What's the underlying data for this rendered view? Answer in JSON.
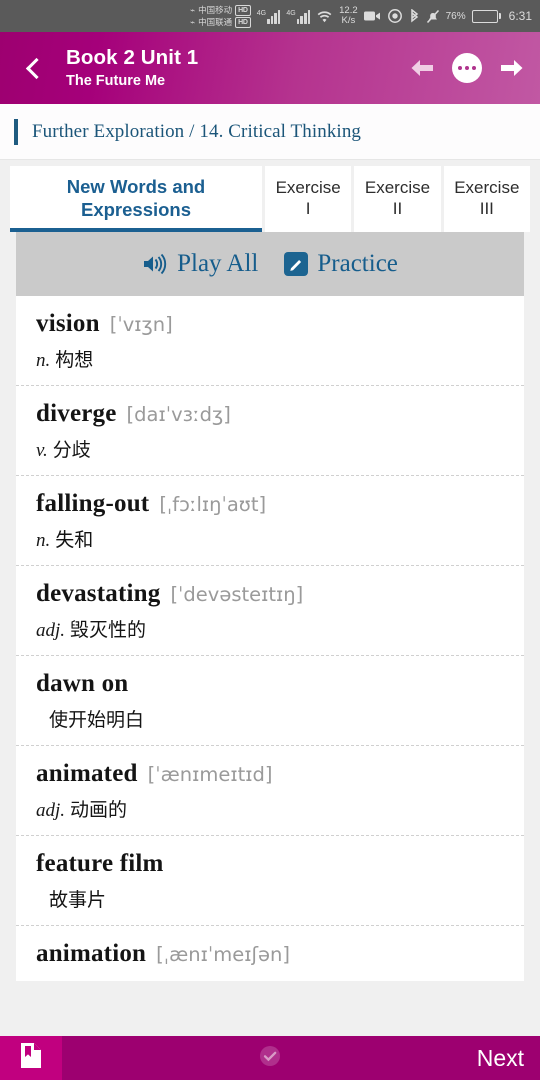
{
  "statusbar": {
    "carrier_1": "中国移动",
    "carrier_2": "中国联通",
    "hd_badge_1": "HD",
    "hd_badge_2": "HD",
    "network_1": "4G",
    "network_2": "4G",
    "data_speed": "12.2",
    "data_speed_unit": "K/s",
    "battery_percent": "76%",
    "clock": "6:31",
    "icons": [
      "wifi-icon",
      "video-recorder-icon",
      "eye-icon",
      "bluetooth-icon",
      "mute-bell-icon",
      "battery-icon"
    ]
  },
  "header": {
    "title": "Book 2 Unit 1",
    "subtitle": "The Future Me",
    "back_icon": "chevron-left-icon",
    "prev_icon": "arrow-left-icon",
    "more_icon": "more-dots-icon",
    "next_icon": "arrow-right-icon",
    "gradient_start": "#9d0070",
    "gradient_end": "#c158a3"
  },
  "breadcrumb": {
    "text": "Further Exploration / 14. Critical Thinking",
    "accent_color": "#1f5b80"
  },
  "tabs": [
    {
      "label": "New Words and Expressions",
      "active": true
    },
    {
      "label": "Exercise I",
      "line1": "Exercise",
      "line2": "I",
      "active": false
    },
    {
      "label": "Exercise II",
      "line1": "Exercise",
      "line2": "II",
      "active": false
    },
    {
      "label": "Exercise III",
      "line1": "Exercise",
      "line2": "III",
      "active": false
    }
  ],
  "toolbar": {
    "play_all_label": "Play All",
    "play_all_icon": "speaker-icon",
    "practice_label": "Practice",
    "practice_icon": "pencil-icon",
    "accent_color": "#165d8c",
    "background_color": "#cacaca"
  },
  "words": [
    {
      "term": "vision",
      "phonetic": "[ˈvɪʒn]",
      "pos": "n.",
      "definition": "构想"
    },
    {
      "term": "diverge",
      "phonetic": "[daɪˈvɜːdʒ]",
      "pos": "v.",
      "definition": "分歧"
    },
    {
      "term": "falling-out",
      "phonetic": "[ˌfɔːlɪŋˈaʊt]",
      "pos": "n.",
      "definition": "失和"
    },
    {
      "term": "devastating",
      "phonetic": "[ˈdevəsteɪtɪŋ]",
      "pos": "adj.",
      "definition": "毁灭性的"
    },
    {
      "term": "dawn on",
      "phonetic": "",
      "pos": "",
      "definition": "使开始明白"
    },
    {
      "term": "animated",
      "phonetic": "[ˈænɪmeɪtɪd]",
      "pos": "adj.",
      "definition": "动画的"
    },
    {
      "term": "feature film",
      "phonetic": "",
      "pos": "",
      "definition": "故事片"
    },
    {
      "term": "animation",
      "phonetic": "[ˌænɪˈmeɪʃən]",
      "pos": "",
      "definition": ""
    }
  ],
  "bottombar": {
    "bookmark_icon": "document-bookmark-icon",
    "check_icon": "check-circle-icon",
    "next_label": "Next",
    "background_color": "#9d0070",
    "accent_color": "#c1007f"
  }
}
